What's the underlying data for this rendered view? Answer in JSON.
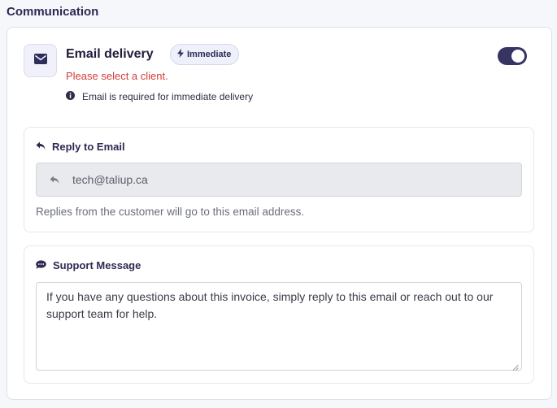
{
  "section": {
    "title": "Communication"
  },
  "email_delivery": {
    "title": "Email delivery",
    "badge": "Immediate",
    "toggle_on": true,
    "error": "Please select a client.",
    "info": "Email is required for immediate delivery"
  },
  "reply_to": {
    "title": "Reply to Email",
    "value": "tech@taliup.ca",
    "help": "Replies from the customer will go to this email address."
  },
  "support_message": {
    "title": "Support Message",
    "value": "If you have any questions about this invoice, simply reply to this email or reach out to our support team for help."
  },
  "colors": {
    "accent": "#353463",
    "error": "#d43b3b",
    "input_disabled_bg": "#e9eaee"
  },
  "icons": [
    "envelope-icon",
    "bolt-icon",
    "info-icon",
    "reply-icon",
    "comment-icon"
  ]
}
